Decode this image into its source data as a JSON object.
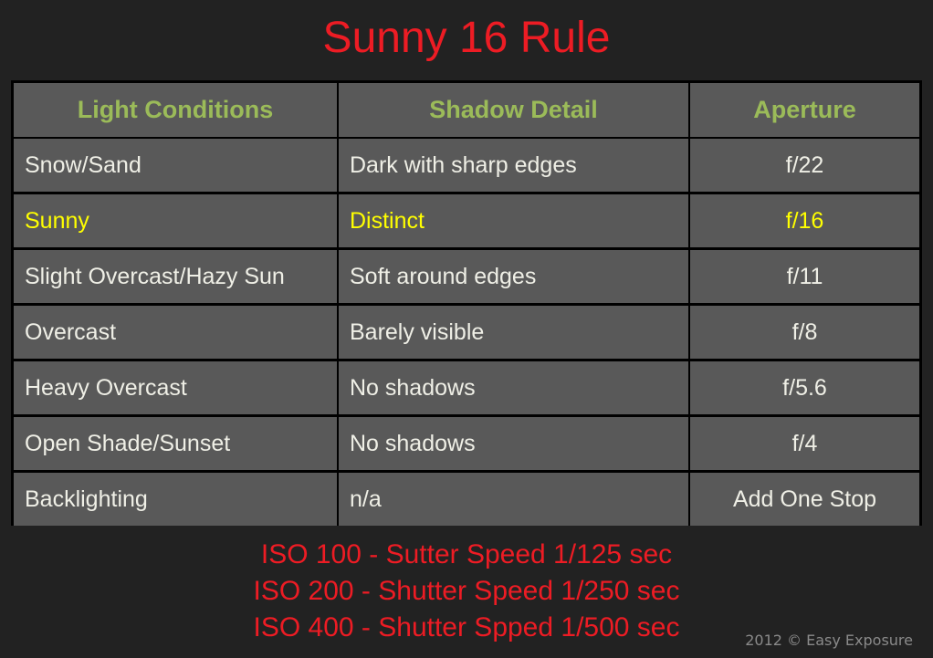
{
  "title": "Sunny 16 Rule",
  "table": {
    "headers": [
      "Light Conditions",
      "Shadow Detail",
      "Aperture"
    ],
    "rows": [
      {
        "condition": "Snow/Sand",
        "shadow": "Dark with sharp edges",
        "aperture": "f/22",
        "highlighted": false
      },
      {
        "condition": "Sunny",
        "shadow": "Distinct",
        "aperture": "f/16",
        "highlighted": true
      },
      {
        "condition": "Slight Overcast/Hazy Sun",
        "shadow": "Soft around edges",
        "aperture": "f/11",
        "highlighted": false
      },
      {
        "condition": "Overcast",
        "shadow": "Barely visible",
        "aperture": "f/8",
        "highlighted": false
      },
      {
        "condition": "Heavy Overcast",
        "shadow": "No shadows",
        "aperture": "f/5.6",
        "highlighted": false
      },
      {
        "condition": "Open Shade/Sunset",
        "shadow": "No shadows",
        "aperture": "f/4",
        "highlighted": false
      },
      {
        "condition": "Backlighting",
        "shadow": "n/a",
        "aperture": "Add One Stop",
        "highlighted": false
      }
    ]
  },
  "iso_notes": [
    "ISO 100 - Sutter Speed 1/125 sec",
    "ISO 200 - Shutter Speed 1/250 sec",
    "ISO 400 - Shutter Spped 1/500 sec"
  ],
  "copyright": "2012 © Easy Exposure",
  "colors": {
    "title": "#ed1c24",
    "header_text": "#9bbb59",
    "highlight_text": "#ffff00",
    "cell_text": "#efefe6",
    "cell_bg": "#595959",
    "page_bg": "#222222"
  }
}
